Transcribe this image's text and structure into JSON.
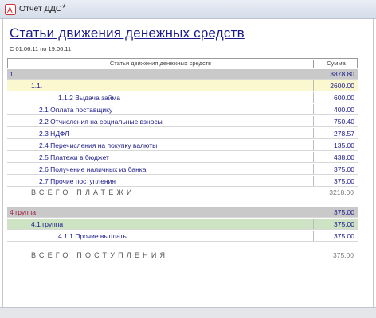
{
  "window": {
    "title": "Отчет ДДС",
    "modified_mark": "*"
  },
  "report": {
    "title": "Статьи движения денежных средств",
    "period": "С 01.06.11 по 19.06.11"
  },
  "table": {
    "headers": {
      "name": "Статьи движения денежных средств",
      "sum": "Сумма"
    },
    "group1": {
      "label": "1.",
      "sum": "3878.80"
    },
    "subgroup1": {
      "label": "1.1.",
      "sum": "2600.00"
    },
    "payments": [
      {
        "label": "1.1.2 Выдача займа",
        "sum": "600.00"
      },
      {
        "label": "2.1 Оплата поставщику",
        "sum": "400.00"
      },
      {
        "label": "2.2 Отчисления на социальные взносы",
        "sum": "750.40"
      },
      {
        "label": "2.3 НДФЛ",
        "sum": "278.57"
      },
      {
        "label": "2.4 Перечисления на покупку валюты",
        "sum": "135.00"
      },
      {
        "label": "2.5 Платежи в бюджет",
        "sum": "438.00"
      },
      {
        "label": "2.6 Получение наличных из банка",
        "sum": "375.00"
      },
      {
        "label": "2.7 Прочие поступления",
        "sum": "375.00"
      }
    ],
    "total_payments": {
      "label": "ВСЕГО ПЛАТЕЖИ",
      "sum": "3218.00"
    },
    "group2": {
      "label": "4 группа",
      "sum": "375.00"
    },
    "subgroup2": {
      "label": "4.1 группа",
      "sum": "375.00"
    },
    "receipts": [
      {
        "label": "4.1.1 Прочие выплаты",
        "sum": "375.00"
      }
    ],
    "total_receipts": {
      "label": "ВСЕГО ПОСТУПЛЕНИЯ",
      "sum": "375.00"
    }
  }
}
